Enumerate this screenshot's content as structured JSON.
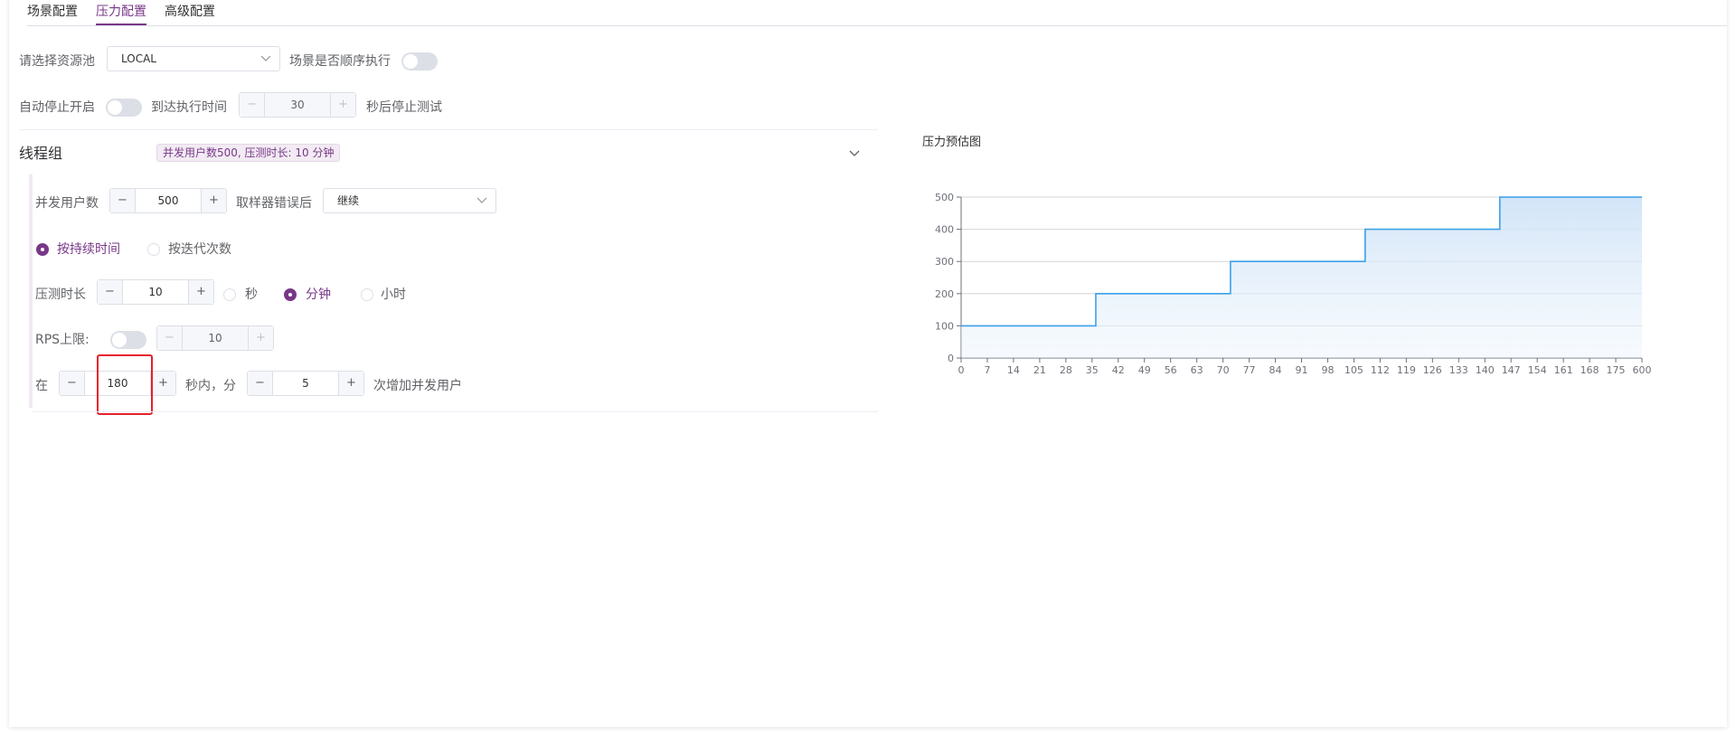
{
  "tabs": [
    {
      "label": "场景配置",
      "active": false
    },
    {
      "label": "压力配置",
      "active": true
    },
    {
      "label": "高级配置",
      "active": false
    }
  ],
  "resource_pool": {
    "label": "请选择资源池",
    "value": "LOCAL"
  },
  "scenario_sequential": {
    "label": "场景是否顺序执行",
    "on": false
  },
  "auto_stop": {
    "label": "自动停止开启",
    "on": false,
    "time_label": "到达执行时间",
    "seconds": "30",
    "suffix": "秒后停止测试"
  },
  "thread_group": {
    "title": "线程组",
    "tag": "并发用户数500, 压测时长: 10 分钟",
    "concurrent_users": {
      "label": "并发用户数",
      "value": "500"
    },
    "sampler_error": {
      "label": "取样器错误后",
      "value": "继续"
    },
    "mode_options": [
      {
        "label": "按持续时间",
        "checked": true
      },
      {
        "label": "按迭代次数",
        "checked": false
      }
    ],
    "duration": {
      "label": "压测时长",
      "value": "10"
    },
    "unit_options": [
      {
        "label": "秒",
        "checked": false
      },
      {
        "label": "分钟",
        "checked": true
      },
      {
        "label": "小时",
        "checked": false
      }
    ],
    "rps": {
      "label": "RPS上限:",
      "on": false,
      "value": "10"
    },
    "ramp": {
      "prefix": "在",
      "seconds": "180",
      "middle": "秒内，分",
      "steps": "5",
      "suffix": "次增加并发用户"
    }
  },
  "chart_title": "压力预估图",
  "chart_data": {
    "type": "line",
    "step": "end",
    "area_fill": true,
    "color": "#3ba1e8",
    "x_categories": [
      "0",
      "7",
      "14",
      "21",
      "28",
      "35",
      "42",
      "49",
      "56",
      "63",
      "70",
      "77",
      "84",
      "91",
      "98",
      "105",
      "112",
      "119",
      "126",
      "133",
      "140",
      "147",
      "154",
      "161",
      "168",
      "175",
      "600"
    ],
    "series": [
      {
        "x": [
          0,
          36,
          72,
          108,
          144,
          180
        ],
        "y": [
          100,
          200,
          300,
          400,
          500,
          500
        ]
      }
    ],
    "yticks": [
      0,
      100,
      200,
      300,
      400,
      500
    ],
    "ylim": [
      0,
      500
    ],
    "grid": true
  }
}
